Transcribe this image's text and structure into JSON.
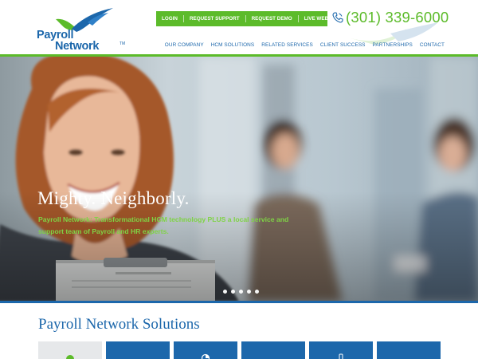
{
  "brand": {
    "logo_line1": "Payroll",
    "logo_line2": "Network",
    "logo_tm": "TM",
    "primary_color": "#1c67ab",
    "accent_color": "#5cbb2a"
  },
  "header": {
    "utility_links": [
      "LOGIN",
      "REQUEST SUPPORT",
      "REQUEST DEMO",
      "LIVE WEBINARS"
    ],
    "phone": "(301) 339-6000",
    "phone_icon": "phone-icon",
    "nav": [
      "OUR COMPANY",
      "HCM SOLUTIONS",
      "RELATED SERVICES",
      "CLIENT SUCCESS",
      "PARTNERSHIPS",
      "CONTACT"
    ]
  },
  "hero": {
    "headline": "Mighty. Neighborly.",
    "subtext": "Payroll Network: Transformational HCM technology PLUS a local service and support team of Payroll and HR experts.",
    "slide_count": 5
  },
  "solutions": {
    "title": "Payroll Network Solutions",
    "tiles": [
      {
        "icon": "circle-icon",
        "active": true
      },
      {
        "icon": "blank-icon",
        "active": false
      },
      {
        "icon": "chart-icon",
        "active": false
      },
      {
        "icon": "blank-icon",
        "active": false
      },
      {
        "icon": "device-icon",
        "active": false
      },
      {
        "icon": "blank-icon",
        "active": false
      }
    ]
  }
}
